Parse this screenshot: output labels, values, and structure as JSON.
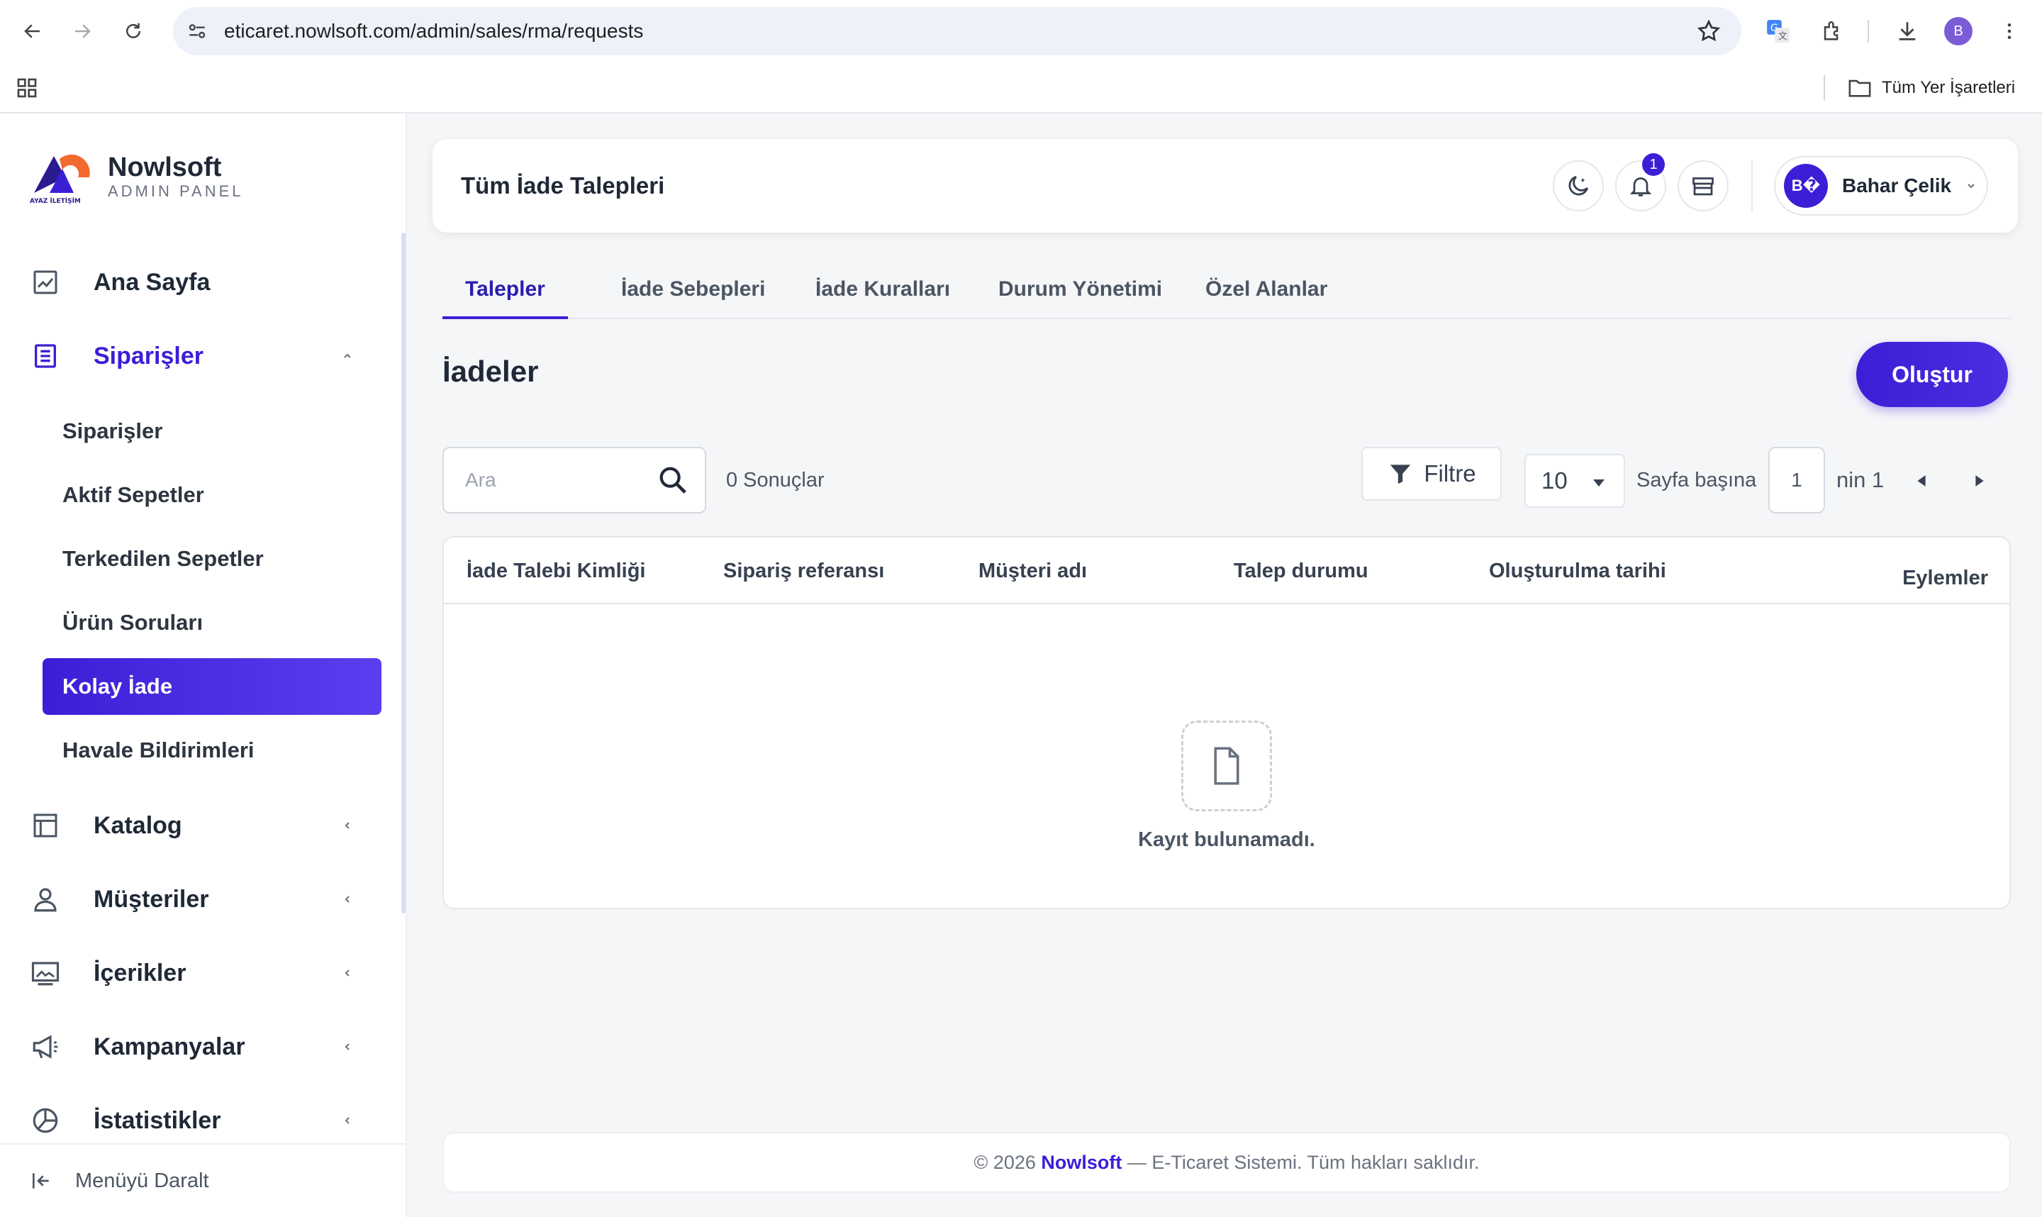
{
  "browser": {
    "url": "eticaret.nowlsoft.com/admin/sales/rma/requests",
    "profile_initial": "B",
    "bookmarks_all_label": "Tüm Yer İşaretleri"
  },
  "brand": {
    "name": "Nowlsoft",
    "subtitle": "ADMIN PANEL",
    "logo_text": "AYAZ İLETİŞİM"
  },
  "sidebar": {
    "menu": [
      {
        "label": "Ana Sayfa",
        "icon": "chart-icon"
      },
      {
        "label": "Siparişler",
        "icon": "orders-icon",
        "active": true,
        "expanded": true
      },
      {
        "label": "Katalog",
        "icon": "catalog-icon"
      },
      {
        "label": "Müşteriler",
        "icon": "user-icon"
      },
      {
        "label": "İçerikler",
        "icon": "content-icon"
      },
      {
        "label": "Kampanyalar",
        "icon": "megaphone-icon"
      },
      {
        "label": "İstatistikler",
        "icon": "pie-icon"
      }
    ],
    "submenu": [
      {
        "label": "Siparişler"
      },
      {
        "label": "Aktif Sepetler"
      },
      {
        "label": "Terkedilen Sepetler"
      },
      {
        "label": "Ürün Soruları"
      },
      {
        "label": "Kolay İade",
        "active": true
      },
      {
        "label": "Havale Bildirimleri"
      }
    ],
    "collapse_label": "Menüyü Daralt"
  },
  "header": {
    "title": "Tüm İade Talepleri",
    "notification_count": "1",
    "user_initials": "B�",
    "user_name": "Bahar Çelik"
  },
  "tabs": [
    {
      "label": "Talepler",
      "active": true
    },
    {
      "label": "İade Sebepleri"
    },
    {
      "label": "İade Kuralları"
    },
    {
      "label": "Durum Yönetimi"
    },
    {
      "label": "Özel Alanlar"
    }
  ],
  "main": {
    "section_title": "İadeler",
    "create_label": "Oluştur",
    "search_placeholder": "Ara",
    "results_text": "0 Sonuçlar",
    "filter_label": "Filtre",
    "per_page_value": "10",
    "per_page_label": "Sayfa başına",
    "current_page": "1",
    "page_of_text": "nin 1"
  },
  "table": {
    "columns": [
      "İade Talebi Kimliği",
      "Sipariş referansı",
      "Müşteri adı",
      "Talep durumu",
      "Oluşturulma tarihi",
      "Eylemler"
    ],
    "empty_text": "Kayıt bulunamadı."
  },
  "footer": {
    "prefix": "© 2026 ",
    "brand": "Nowlsoft",
    "suffix": " — E-Ticaret Sistemi. Tüm hakları saklıdır."
  },
  "colors": {
    "accent": "#3b1fd6",
    "page_bg": "#f5f6f8"
  }
}
